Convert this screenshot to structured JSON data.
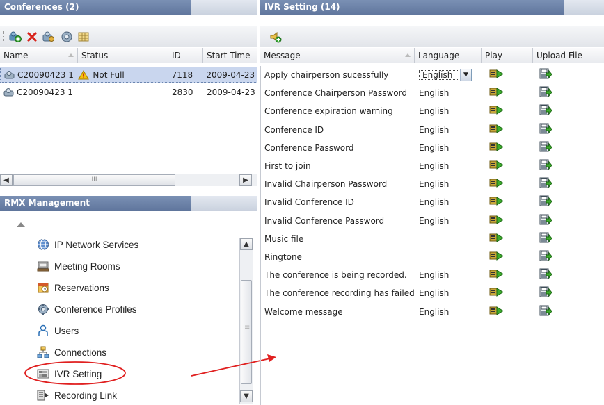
{
  "conferences": {
    "title": "Conferences (2)",
    "columns": [
      "Name",
      "Status",
      "ID",
      "Start Time"
    ],
    "rows": [
      {
        "name": "C20090423 1",
        "status": "Not Full",
        "id": "7118",
        "start": "2009-04-23",
        "selected": true
      },
      {
        "name": "C20090423 1",
        "status": "",
        "id": "2830",
        "start": "2009-04-23",
        "selected": false
      }
    ],
    "scroll_thumb_label": "III"
  },
  "rmx": {
    "title": "RMX Management",
    "items": [
      {
        "label": "IP Network Services",
        "icon": "globe-icon"
      },
      {
        "label": "Meeting Rooms",
        "icon": "meeting-room-icon"
      },
      {
        "label": "Reservations",
        "icon": "calendar-icon"
      },
      {
        "label": "Conference Profiles",
        "icon": "profile-icon"
      },
      {
        "label": "Users",
        "icon": "user-icon"
      },
      {
        "label": "Connections",
        "icon": "connections-icon"
      },
      {
        "label": "IVR Setting",
        "icon": "ivr-icon"
      },
      {
        "label": "Recording Link",
        "icon": "recording-link-icon"
      }
    ],
    "scroll_thumb_label": "≡"
  },
  "ivr": {
    "title": "IVR Setting (14)",
    "columns": [
      "Message",
      "Language",
      "Play",
      "Upload File"
    ],
    "rows": [
      {
        "message": "Apply chairperson sucessfully",
        "language": "English",
        "editing": true
      },
      {
        "message": "Conference Chairperson Password",
        "language": "English"
      },
      {
        "message": "Conference expiration warning",
        "language": "English"
      },
      {
        "message": "Conference ID",
        "language": "English"
      },
      {
        "message": "Conference Password",
        "language": "English"
      },
      {
        "message": "First to join",
        "language": "English"
      },
      {
        "message": "Invalid Chairperson Password",
        "language": "English"
      },
      {
        "message": "Invalid Conference ID",
        "language": "English"
      },
      {
        "message": "Invalid Conference Password",
        "language": "English"
      },
      {
        "message": "Music file",
        "language": ""
      },
      {
        "message": "Ringtone",
        "language": ""
      },
      {
        "message": "The conference is being recorded.",
        "language": "English"
      },
      {
        "message": "The conference recording has failed.",
        "language": "English"
      },
      {
        "message": "Welcome message",
        "language": "English"
      }
    ]
  },
  "colors": {
    "header": "#6b82a8",
    "selected_row": "#c9d6ee",
    "annotation": "#e02020"
  }
}
